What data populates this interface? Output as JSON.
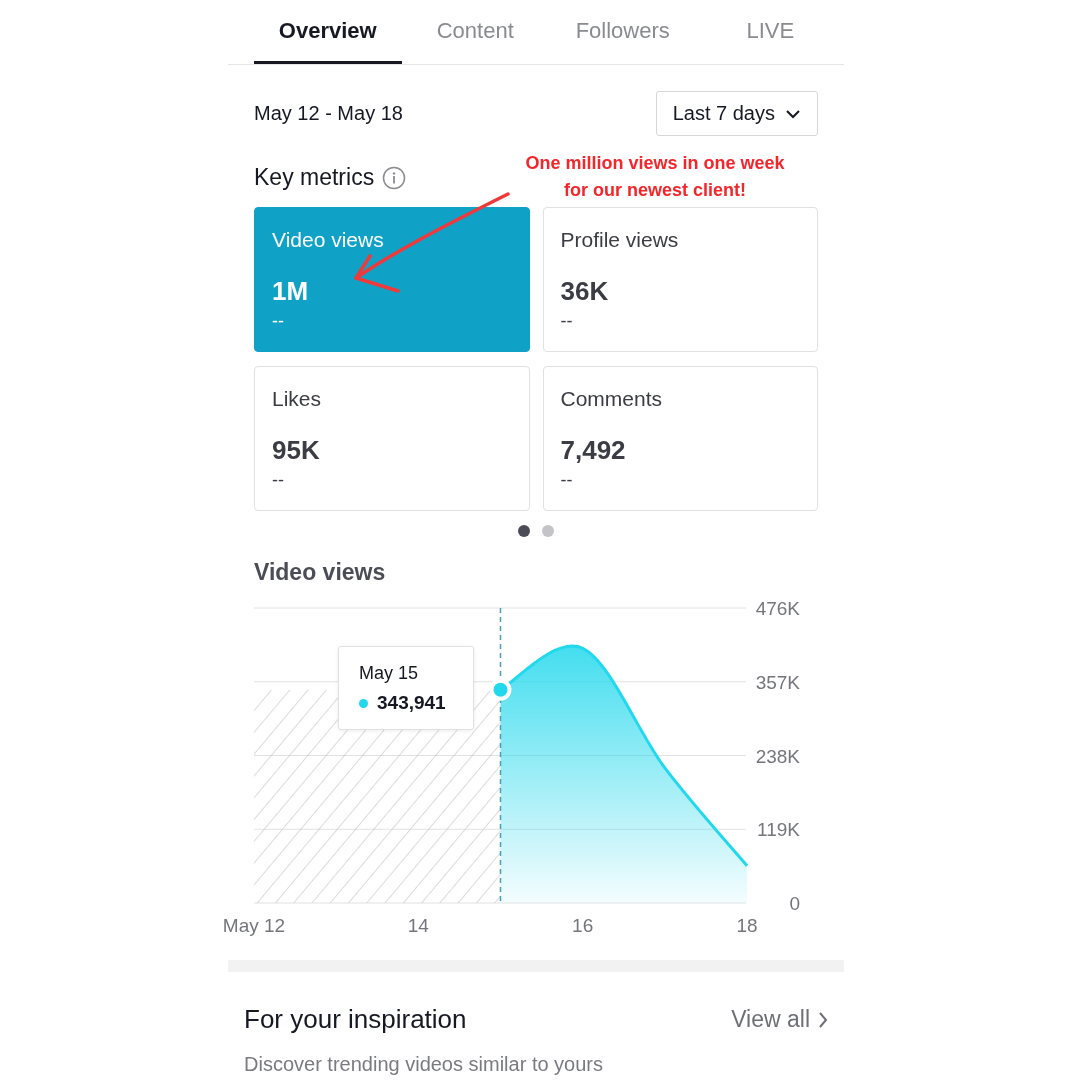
{
  "tabs": [
    {
      "label": "Overview",
      "selected": true
    },
    {
      "label": "Content",
      "selected": false
    },
    {
      "label": "Followers",
      "selected": false
    },
    {
      "label": "LIVE",
      "selected": false
    }
  ],
  "date_range": "May 12 - May 18",
  "period_select": {
    "value": "Last 7 days"
  },
  "key_metrics": {
    "title": "Key metrics",
    "cards": [
      {
        "label": "Video views",
        "value": "1M",
        "change": "--",
        "selected": true
      },
      {
        "label": "Profile views",
        "value": "36K",
        "change": "--",
        "selected": false
      },
      {
        "label": "Likes",
        "value": "95K",
        "change": "--",
        "selected": false
      },
      {
        "label": "Comments",
        "value": "7,492",
        "change": "--",
        "selected": false
      }
    ]
  },
  "pager": [
    {
      "selected": true
    },
    {
      "selected": false
    }
  ],
  "chart": {
    "title": "Video views",
    "tooltip": {
      "date": "May 15",
      "value": "343,941"
    },
    "chart_data": {
      "type": "area",
      "x": [
        15,
        16,
        17,
        18
      ],
      "grid": true,
      "ref_lines": [
        {
          "axis": "x",
          "value": 15
        }
      ],
      "series": [
        {
          "color": "#22d8ec",
          "values": [
            344000,
            411000,
            218000,
            60000
          ]
        }
      ],
      "xlim": [
        12,
        18
      ],
      "ylim": [
        0,
        476000
      ],
      "yticks": [
        {
          "value": 0,
          "label": "0"
        },
        {
          "value": 119000,
          "label": "119K"
        },
        {
          "value": 238000,
          "label": "238K"
        },
        {
          "value": 357000,
          "label": "357K"
        },
        {
          "value": 476000,
          "label": "476K"
        }
      ],
      "xticks": [
        {
          "value": 12,
          "label": "May 12"
        },
        {
          "value": 14,
          "label": "14"
        },
        {
          "value": 16,
          "label": "16"
        },
        {
          "value": 18,
          "label": "18"
        }
      ]
    }
  },
  "inspiration": {
    "title": "For your inspiration",
    "link": "View all",
    "subtitle": "Discover trending videos similar to yours"
  },
  "annotation": {
    "lines": [
      "One million views in one week",
      "for our newest client!"
    ]
  }
}
